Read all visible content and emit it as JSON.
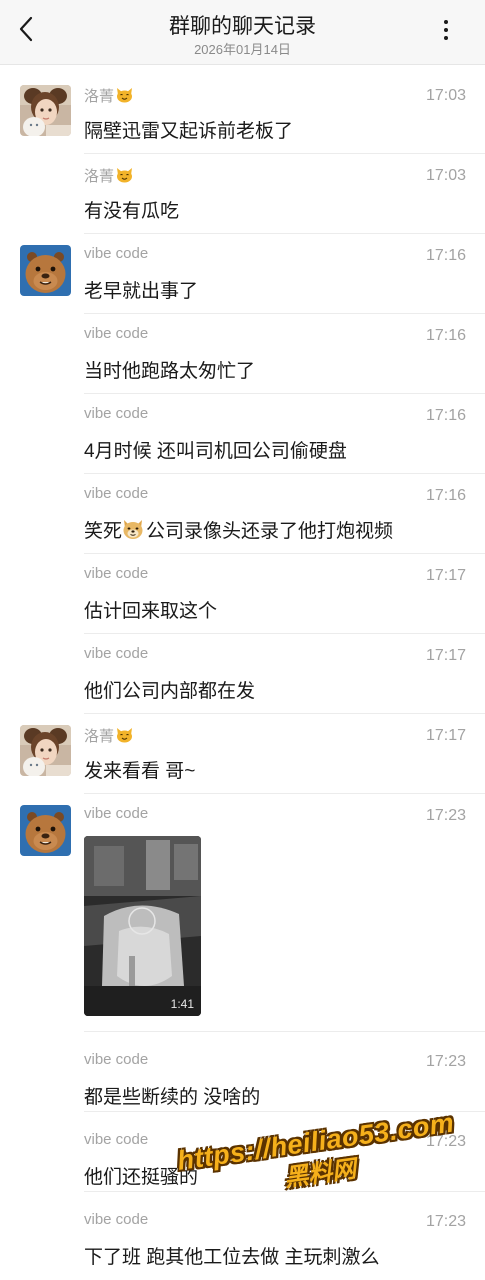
{
  "header": {
    "title": "群聊的聊天记录",
    "subtitle": "2026年01月14日",
    "back_icon": "chevron-left-icon",
    "more_icon": "more-vertical-icon"
  },
  "messages": [
    {
      "sender": "洛菁",
      "time": "17:03",
      "text": "隔壁迅雷又起诉前老板了",
      "avatar": "girl-with-cat"
    },
    {
      "sender": "洛菁",
      "time": "17:03",
      "text": "有没有瓜吃"
    },
    {
      "sender": "vibe code",
      "time": "17:16",
      "text": "老早就出事了",
      "avatar": "capybara"
    },
    {
      "sender": "vibe code",
      "time": "17:16",
      "text": "当时他跑路太匆忙了"
    },
    {
      "sender": "vibe code",
      "time": "17:16",
      "text": "4月时候 还叫司机回公司偷硬盘"
    },
    {
      "sender": "vibe code",
      "time": "17:16",
      "text_before": "笑死",
      "text_after": "公司录像头还录了他打炮视频",
      "emoji": "doge-emoji"
    },
    {
      "sender": "vibe code",
      "time": "17:17",
      "text": "估计回来取这个"
    },
    {
      "sender": "vibe code",
      "time": "17:17",
      "text": "他们公司内部都在发"
    },
    {
      "sender": "洛菁",
      "time": "17:17",
      "text": "发来看看 哥~",
      "avatar": "girl-with-cat"
    },
    {
      "sender": "vibe code",
      "time": "17:23",
      "video_duration": "1:41",
      "avatar": "capybara"
    },
    {
      "sender": "vibe code",
      "time": "17:23",
      "text": "都是些断续的 没啥的"
    },
    {
      "sender": "vibe code",
      "time": "17:23",
      "text": "他们还挺骚的"
    },
    {
      "sender": "vibe code",
      "time": "17:23",
      "text": "下了班 跑其他工位去做 主玩刺激么"
    }
  ],
  "sender_emoji": "cat-face-emoji",
  "watermark": {
    "line1": "https://heiliao53.com",
    "line2": "黑料网"
  },
  "colors": {
    "header_bg": "#f7f7f7",
    "meta_text": "#a3a3a3",
    "body_text": "#1a1a1a",
    "watermark": "#f5b01b"
  }
}
